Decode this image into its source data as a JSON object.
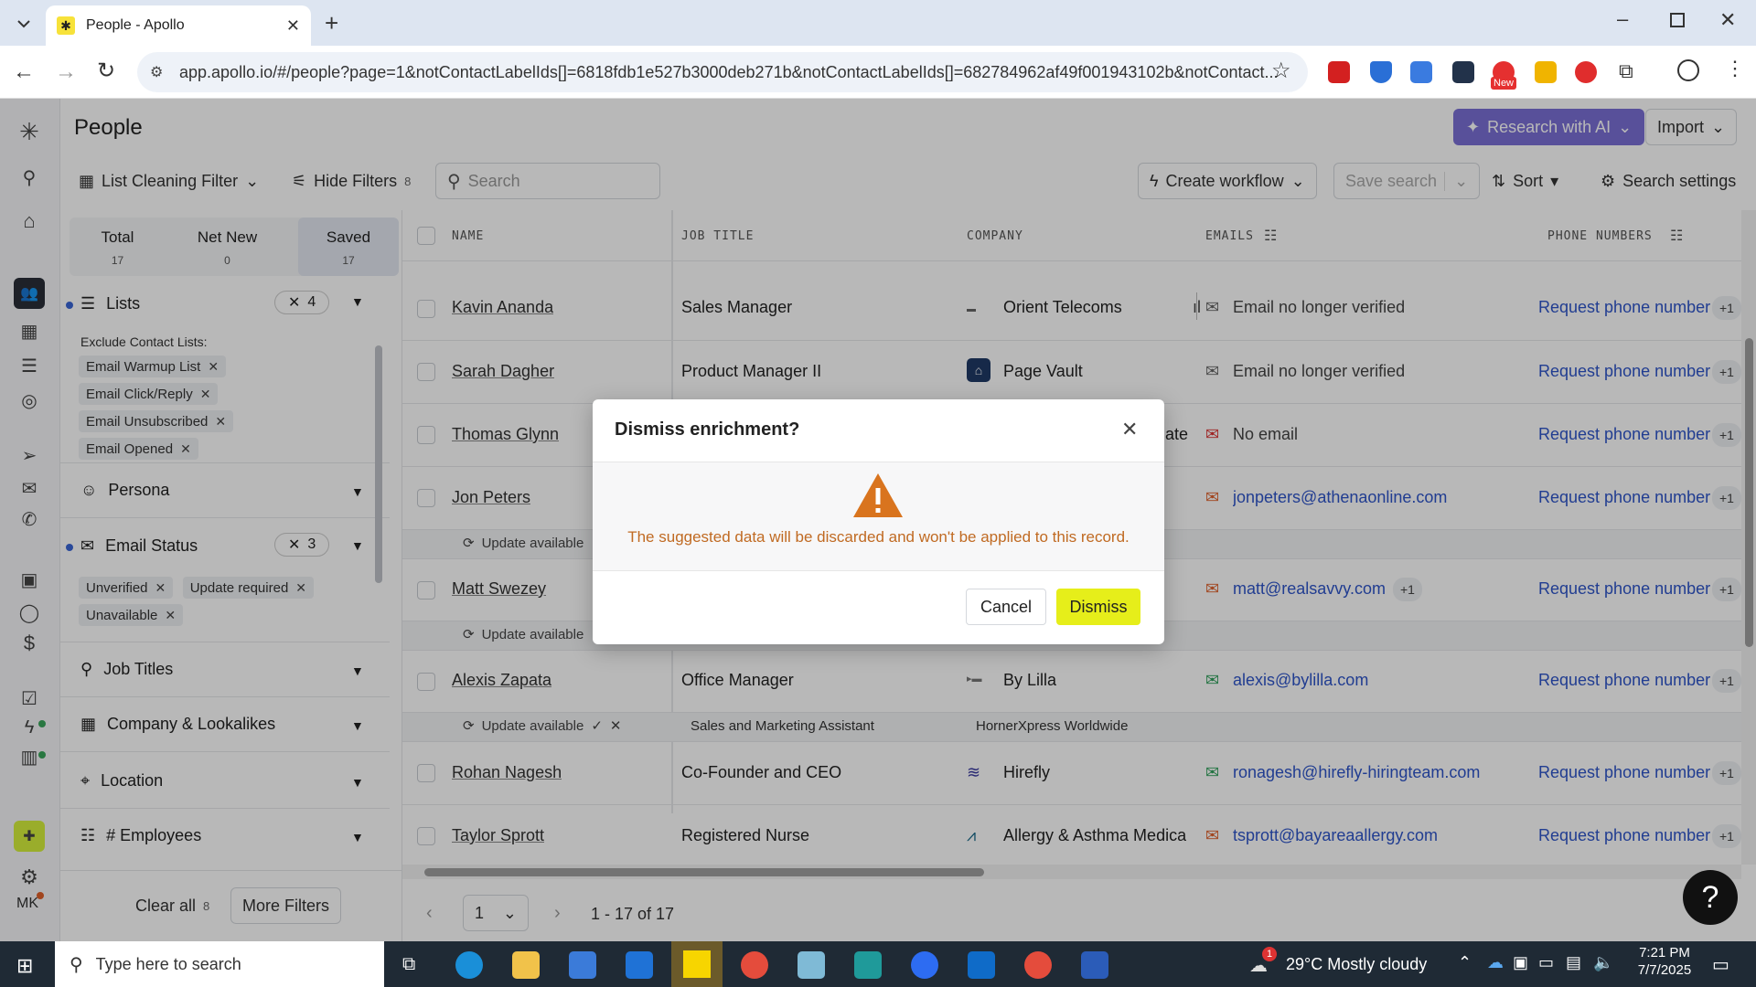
{
  "browser": {
    "tab_title": "People - Apollo",
    "url": "app.apollo.io/#/people?page=1&notContactLabelIds[]=6818fdb1e527b3000deb271b&notContactLabelIds[]=682784962af49f001943102b&notContact...",
    "new_badge": "New"
  },
  "page": {
    "title": "People",
    "research_ai_label": "Research with AI",
    "import_label": "Import",
    "avatar_initials": "MK"
  },
  "toolbar": {
    "list_filter_label": "List Cleaning Filter",
    "hide_filters_label": "Hide Filters",
    "hide_filters_count": "8",
    "search_placeholder": "Search",
    "create_workflow_label": "Create workflow",
    "save_search_label": "Save search",
    "sort_label": "Sort",
    "search_settings_label": "Search settings"
  },
  "sidebar": {
    "tabs": [
      {
        "label": "Total",
        "count": "17"
      },
      {
        "label": "Net New",
        "count": "0"
      },
      {
        "label": "Saved",
        "count": "17"
      }
    ],
    "lists": {
      "label": "Lists",
      "badge": "4",
      "exclude_label": "Exclude Contact Lists:",
      "chips": [
        "Email Warmup List",
        "Email Click/Reply",
        "Email Unsubscribed",
        "Email Opened"
      ]
    },
    "persona_label": "Persona",
    "email_status": {
      "label": "Email Status",
      "badge": "3",
      "chips": [
        "Unverified",
        "Update required",
        "Unavailable"
      ]
    },
    "job_titles_label": "Job Titles",
    "company_label": "Company & Lookalikes",
    "location_label": "Location",
    "employees_label": "# Employees",
    "clear_all_label": "Clear all",
    "clear_all_count": "8",
    "more_filters_label": "More Filters"
  },
  "table": {
    "headers": [
      "NAME",
      "JOB TITLE",
      "COMPANY",
      "EMAILS",
      "PHONE NUMBERS"
    ],
    "update_available_label": "Update available",
    "request_phone_label": "Request phone number",
    "rows": [
      {
        "name": "Kavin Ananda",
        "title": "Sales Manager",
        "company": "Orient Telecoms",
        "email": "Email no longer verified",
        "extra": "+1"
      },
      {
        "name": "Sarah Dagher",
        "title": "Product Manager II",
        "company": "Page Vault",
        "email": "Email no longer verified",
        "extra": "+1"
      },
      {
        "name": "Thomas Glynn",
        "title": "",
        "company": "ate",
        "email": "No email",
        "extra": "+1"
      },
      {
        "name": "Jon Peters",
        "title": "",
        "company": "",
        "email": "jonpeters@athenaonline.com",
        "extra": "+1"
      },
      {
        "name": "Matt Swezey",
        "title": "",
        "company": "",
        "email": "matt@realsavvy.com",
        "email_extra": "+1",
        "extra": "+1"
      },
      {
        "name": "Alexis Zapata",
        "title": "Office Manager",
        "company": "By Lilla",
        "email": "alexis@bylilla.com",
        "extra": "+1"
      },
      {
        "name": "Rohan Nagesh",
        "title": "Co-Founder and CEO",
        "company": "Hirefly",
        "email": "ronagesh@hirefly-hiringteam.com",
        "extra": "+1"
      },
      {
        "name": "Taylor Sprott",
        "title": "Registered Nurse",
        "company": "Allergy & Asthma Medica",
        "email": "tsprott@bayareaallergy.com",
        "extra": "+1"
      }
    ],
    "alexis_update": {
      "title": "Sales and Marketing Assistant",
      "company": "HornerXpress Worldwide"
    }
  },
  "pagination": {
    "page": "1",
    "range": "1 - 17 of 17"
  },
  "modal": {
    "title": "Dismiss enrichment?",
    "message": "The suggested data will be discarded and won't be applied to this record.",
    "cancel_label": "Cancel",
    "dismiss_label": "Dismiss"
  },
  "help_label": "?",
  "taskbar": {
    "search_placeholder": "Type here to search",
    "weather": "29°C  Mostly cloudy",
    "time": "7:21 PM",
    "date": "7/7/2025",
    "weather_badge": "1"
  },
  "colors": {
    "accent_blue": "#2f55c9",
    "research_ai": "#7b6fd6",
    "dismiss_yellow": "#e6ee1a",
    "warning_orange": "#d9741e"
  }
}
